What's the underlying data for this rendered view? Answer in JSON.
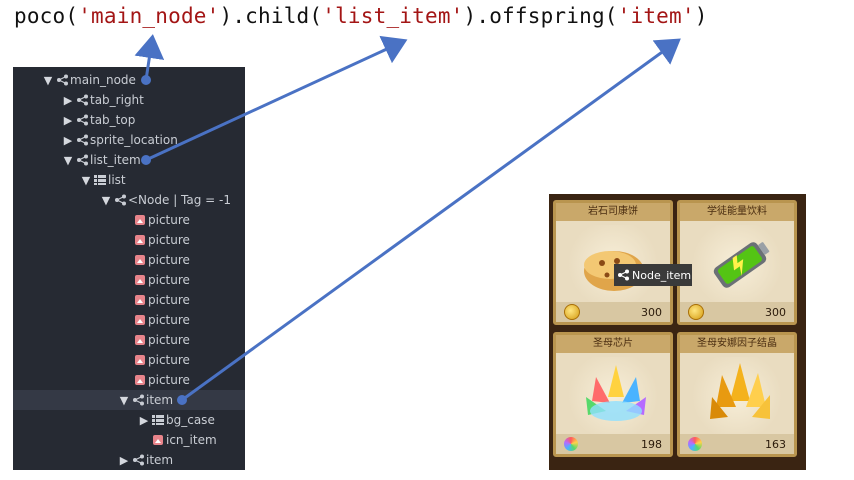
{
  "code": {
    "p1": "poco(",
    "s1": "'main_node'",
    "p2": ").child(",
    "s2": "'list_item'",
    "p3": ").offspring(",
    "s3": "'item'",
    "p4": ")"
  },
  "tree": {
    "rows": [
      {
        "label": "main_node",
        "toggle": "▼",
        "icon": "node-icon"
      },
      {
        "label": "tab_right",
        "toggle": "▶",
        "icon": "node-icon"
      },
      {
        "label": "tab_top",
        "toggle": "▶",
        "icon": "node-icon"
      },
      {
        "label": "sprite_location",
        "toggle": "▶",
        "icon": "node-icon"
      },
      {
        "label": "list_item",
        "toggle": "▼",
        "icon": "node-icon"
      },
      {
        "label": "list",
        "toggle": "▼",
        "icon": "list-icon"
      },
      {
        "label": "<Node | Tag = -1",
        "toggle": "▼",
        "icon": "node-icon"
      },
      {
        "label": "picture",
        "toggle": "",
        "icon": "picture-icon"
      },
      {
        "label": "picture",
        "toggle": "",
        "icon": "picture-icon"
      },
      {
        "label": "picture",
        "toggle": "",
        "icon": "picture-icon"
      },
      {
        "label": "picture",
        "toggle": "",
        "icon": "picture-icon"
      },
      {
        "label": "picture",
        "toggle": "",
        "icon": "picture-icon"
      },
      {
        "label": "picture",
        "toggle": "",
        "icon": "picture-icon"
      },
      {
        "label": "picture",
        "toggle": "",
        "icon": "picture-icon"
      },
      {
        "label": "picture",
        "toggle": "",
        "icon": "picture-icon"
      },
      {
        "label": "picture",
        "toggle": "",
        "icon": "picture-icon"
      },
      {
        "label": "item",
        "toggle": "▼",
        "icon": "node-icon"
      },
      {
        "label": "bg_case",
        "toggle": "▶",
        "icon": "list-icon"
      },
      {
        "label": "icn_item",
        "toggle": "",
        "icon": "picture-icon"
      },
      {
        "label": "item",
        "toggle": "▶",
        "icon": "node-icon"
      }
    ]
  },
  "game": {
    "cards": [
      {
        "title": "岩石司康饼",
        "value": "300",
        "currency": "coin-icon",
        "art": "scone-icon"
      },
      {
        "title": "学徒能量饮料",
        "value": "300",
        "currency": "coin-icon",
        "art": "battery-icon"
      },
      {
        "title": "圣母芯片",
        "value": "198",
        "currency": "gem-icon",
        "art": "rainbow-crystal-icon"
      },
      {
        "title": "圣母安娜因子结晶",
        "value": "163",
        "currency": "gem-icon",
        "art": "gold-crystal-icon"
      }
    ],
    "tooltip": "Node_item"
  },
  "colors": {
    "arrow": "#4a72c4",
    "tree_bg": "#262a33",
    "string": "#a31515"
  }
}
